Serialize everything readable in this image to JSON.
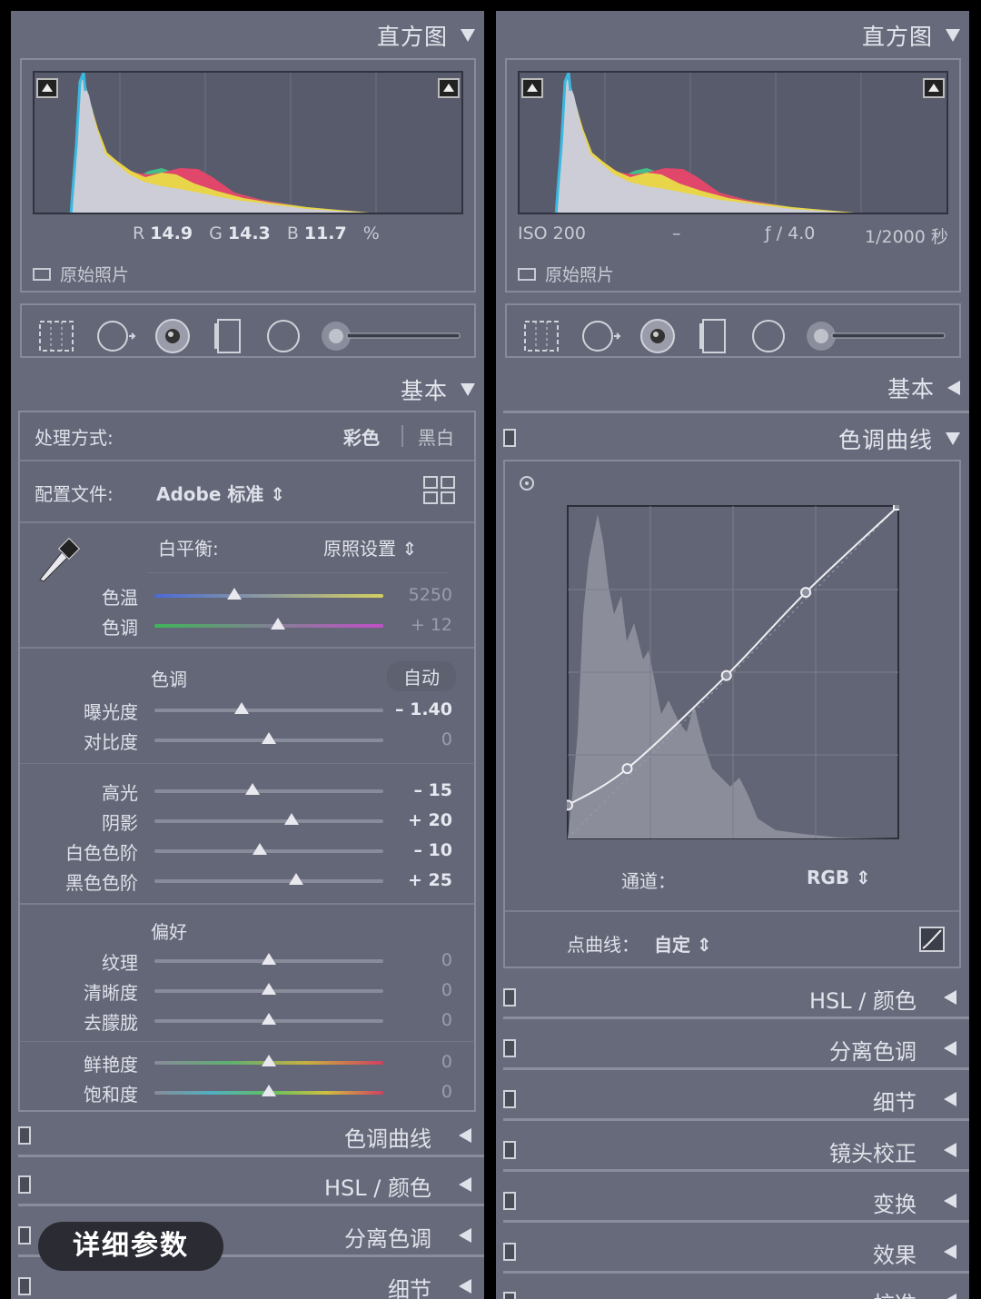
{
  "left": {
    "histogram": {
      "title": "直方图",
      "r_label": "R",
      "r_value": "14.9",
      "g_label": "G",
      "g_value": "14.3",
      "b_label": "B",
      "b_value": "11.7",
      "unit": "%",
      "original_photo": "原始照片"
    },
    "basic": {
      "title": "基本",
      "treatment_label": "处理方式:",
      "treatment_color": "彩色",
      "treatment_bw": "黑白",
      "profile_label": "配置文件:",
      "profile_value": "Adobe 标准 ⇕",
      "wb_label": "白平衡:",
      "wb_value": "原照设置 ⇕",
      "temp": {
        "label": "色温",
        "value": "5250",
        "pos": 0.35
      },
      "tint": {
        "label": "色调",
        "value": "+ 12",
        "pos": 0.54
      },
      "tone_label": "色调",
      "auto_label": "自动",
      "exposure": {
        "label": "曝光度",
        "value": "– 1.40",
        "pos": 0.38
      },
      "contrast": {
        "label": "对比度",
        "value": "0",
        "pos": 0.5
      },
      "highlights": {
        "label": "高光",
        "value": "– 15",
        "pos": 0.43
      },
      "shadows": {
        "label": "阴影",
        "value": "+ 20",
        "pos": 0.6
      },
      "whites": {
        "label": "白色色阶",
        "value": "– 10",
        "pos": 0.46
      },
      "blacks": {
        "label": "黑色色阶",
        "value": "+ 25",
        "pos": 0.62
      },
      "presence_label": "偏好",
      "texture": {
        "label": "纹理",
        "value": "0",
        "pos": 0.5
      },
      "clarity": {
        "label": "清晰度",
        "value": "0",
        "pos": 0.5
      },
      "dehaze": {
        "label": "去朦胧",
        "value": "0",
        "pos": 0.5
      },
      "vibrance": {
        "label": "鲜艳度",
        "value": "0",
        "pos": 0.5
      },
      "saturation": {
        "label": "饱和度",
        "value": "0",
        "pos": 0.5
      }
    },
    "collapsed": [
      "色调曲线",
      "HSL / 颜色",
      "分离色调",
      "细节"
    ],
    "badge": "详细参数"
  },
  "right": {
    "histogram": {
      "title": "直方图",
      "iso": "ISO 200",
      "lens": "–",
      "aperture": "ƒ / 4.0",
      "shutter": "1/2000 秒",
      "original_photo": "原始照片"
    },
    "basic_title": "基本",
    "tone_curve": {
      "title": "色调曲线",
      "channel_label": "通道：",
      "channel_value": "RGB ⇕",
      "point_curve_label": "点曲线：",
      "point_curve_value": "自定 ⇕",
      "points": [
        [
          0,
          0.1
        ],
        [
          0.18,
          0.21
        ],
        [
          0.48,
          0.49
        ],
        [
          0.72,
          0.74
        ],
        [
          1,
          1
        ]
      ]
    },
    "collapsed": [
      "HSL / 颜色",
      "分离色调",
      "细节",
      "镜头校正",
      "变换",
      "效果",
      "校准"
    ]
  },
  "colors": {
    "panel": "#676a7a",
    "accent": "#e0e2ea"
  }
}
